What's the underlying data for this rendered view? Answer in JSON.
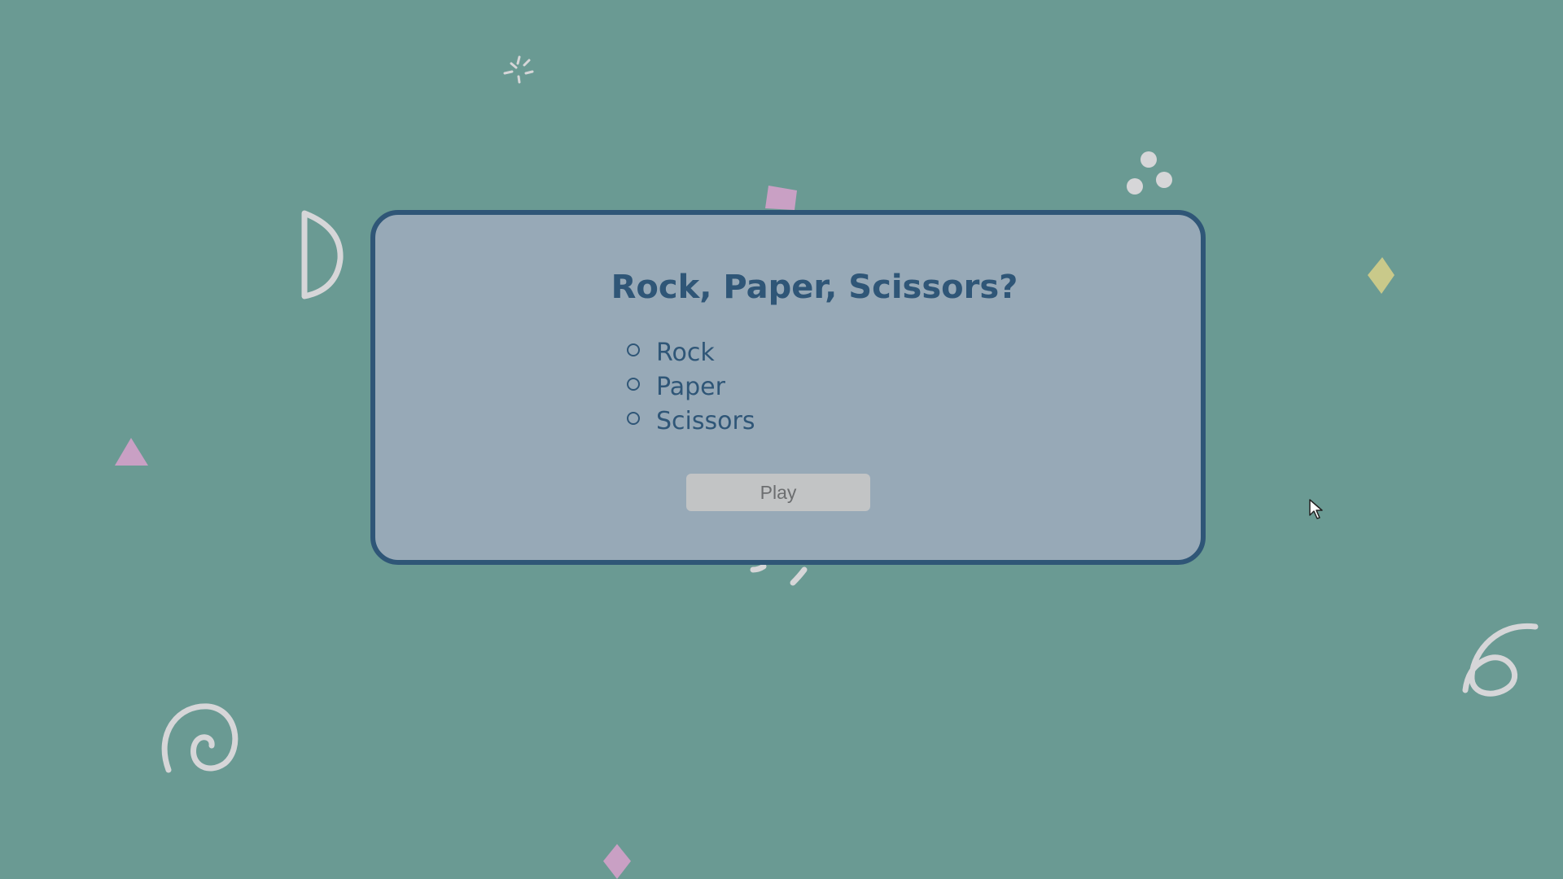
{
  "game": {
    "title": "Rock, Paper, Scissors?",
    "options": [
      {
        "label": "Rock",
        "selected": false
      },
      {
        "label": "Paper",
        "selected": false
      },
      {
        "label": "Scissors",
        "selected": false
      }
    ],
    "play_label": "Play"
  },
  "colors": {
    "background": "#6a9a93",
    "card_background": "#97a9b7",
    "card_border": "#2f5677",
    "text": "#2f5677",
    "button_background": "#c2c4c5",
    "button_text": "#6c6e70",
    "decor_light": "#d6d6d8",
    "decor_pink": "#c9a0c4",
    "decor_yellow": "#c9c98a"
  },
  "decorations": [
    "sparkle-icon",
    "half-circle-icon",
    "pink-square-icon",
    "dots-icon",
    "yellow-diamond-icon",
    "pink-triangle-icon",
    "spiral-icon",
    "squiggle-icon",
    "curl-icon",
    "pink-diamond-icon"
  ]
}
